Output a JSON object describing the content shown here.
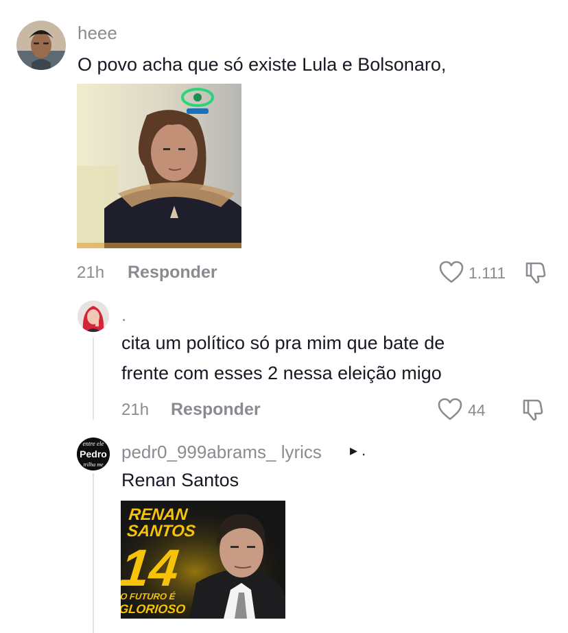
{
  "comments": [
    {
      "username": "heee",
      "text": "O povo acha que só existe Lula e Bolsonaro,",
      "time": "21h",
      "reply_label": "Responder",
      "likes": "1.111"
    }
  ],
  "replies": [
    {
      "username": ".",
      "text_line1": "cita um político só pra mim que bate de",
      "text_line2": "frente com esses 2 nessa eleição migo",
      "time": "21h",
      "reply_label": "Responder",
      "likes": "44"
    },
    {
      "username": "pedr0_999abrams_ lyrics",
      "reply_marker": "▸ .",
      "text": "Renan Santos",
      "avatar_text": [
        "entre ele",
        "Pedro",
        "trilha me"
      ],
      "poster": {
        "line1": "RENAN",
        "line2": "SANTOS",
        "number": "14",
        "tag1": "O FUTURO É",
        "tag2": "GLORIOSO"
      }
    }
  ],
  "colors": {
    "poster_yellow": "#f6c20a",
    "muted": "#8a8b91",
    "text": "#161823"
  },
  "icons": [
    "heart-icon",
    "dislike-icon",
    "tv-logo-icon",
    "play-triangle-icon"
  ]
}
